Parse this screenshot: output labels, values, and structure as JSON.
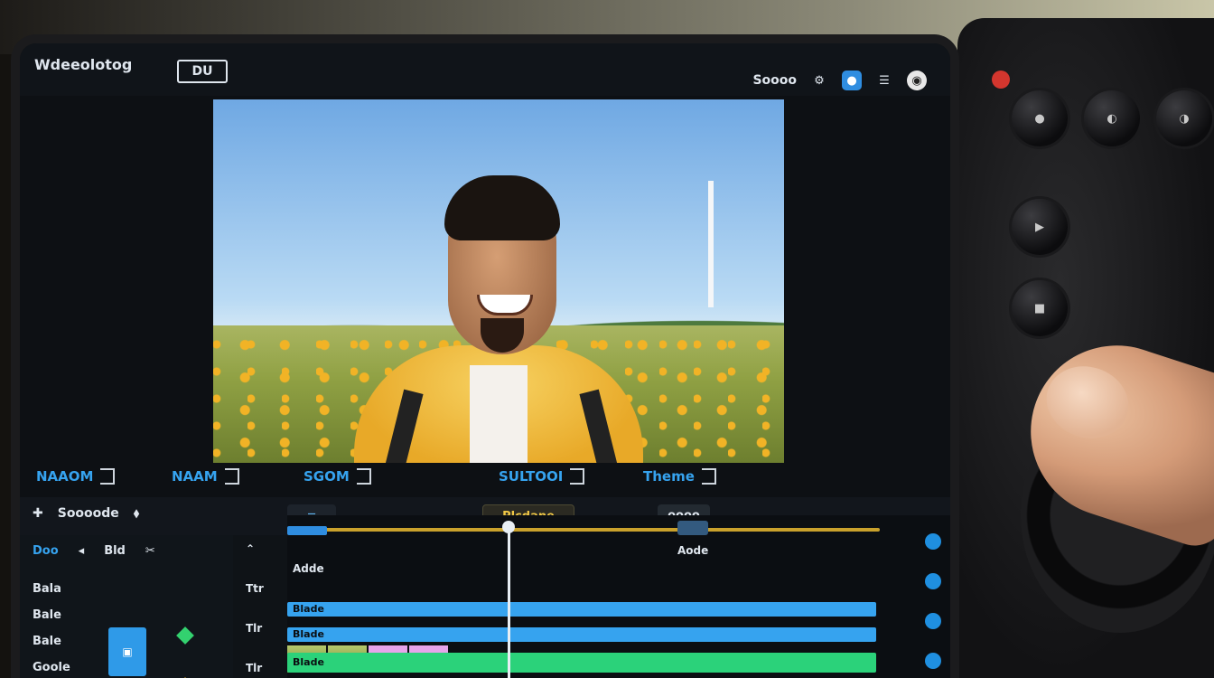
{
  "app": {
    "title": "Wdeeolotog",
    "mode_badge": "DU"
  },
  "topbar": {
    "save_label": "Soooo"
  },
  "track_labels": [
    "NAAOM",
    "NAAM",
    "SGOM",
    "SULTOOI",
    "Theme"
  ],
  "toolbar": {
    "left_label": "Soooode",
    "pill_center": "Plcdane",
    "pill_right": "oooo"
  },
  "panel": {
    "tabs": [
      "Doo",
      "Bld"
    ],
    "items": [
      "Bala",
      "Bale",
      "Bale",
      "Goole"
    ]
  },
  "ruler": {
    "labels": [
      "Ttr",
      "Tlr",
      "Tlr"
    ]
  },
  "timeline": {
    "track_a": "Adde",
    "track_b": "Aode",
    "clip_labels": [
      "Blade",
      "Blade",
      "Blade"
    ]
  },
  "colors": {
    "accent_blue": "#36a3ef",
    "accent_green": "#2bd27a",
    "accent_gold": "#f0c846",
    "record_red": "#d3362e"
  },
  "icons": [
    "settings-icon",
    "grid-icon",
    "user-icon",
    "add-icon",
    "collapse-icon",
    "diamond-icon"
  ]
}
